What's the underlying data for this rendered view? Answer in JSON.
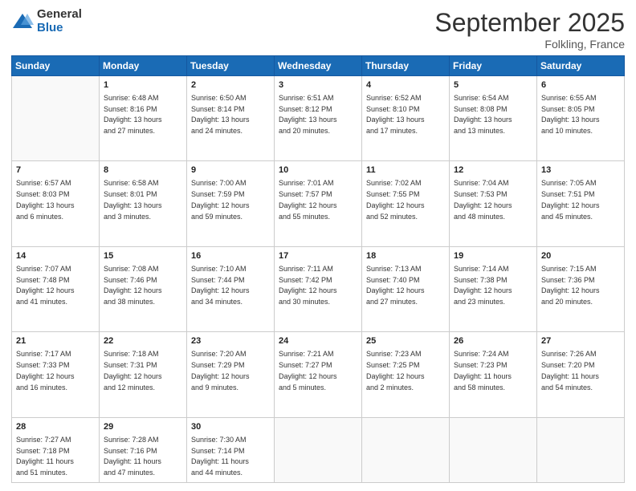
{
  "logo": {
    "general": "General",
    "blue": "Blue"
  },
  "header": {
    "month": "September 2025",
    "location": "Folkling, France"
  },
  "weekdays": [
    "Sunday",
    "Monday",
    "Tuesday",
    "Wednesday",
    "Thursday",
    "Friday",
    "Saturday"
  ],
  "weeks": [
    [
      {
        "day": "",
        "info": ""
      },
      {
        "day": "1",
        "info": "Sunrise: 6:48 AM\nSunset: 8:16 PM\nDaylight: 13 hours\nand 27 minutes."
      },
      {
        "day": "2",
        "info": "Sunrise: 6:50 AM\nSunset: 8:14 PM\nDaylight: 13 hours\nand 24 minutes."
      },
      {
        "day": "3",
        "info": "Sunrise: 6:51 AM\nSunset: 8:12 PM\nDaylight: 13 hours\nand 20 minutes."
      },
      {
        "day": "4",
        "info": "Sunrise: 6:52 AM\nSunset: 8:10 PM\nDaylight: 13 hours\nand 17 minutes."
      },
      {
        "day": "5",
        "info": "Sunrise: 6:54 AM\nSunset: 8:08 PM\nDaylight: 13 hours\nand 13 minutes."
      },
      {
        "day": "6",
        "info": "Sunrise: 6:55 AM\nSunset: 8:05 PM\nDaylight: 13 hours\nand 10 minutes."
      }
    ],
    [
      {
        "day": "7",
        "info": "Sunrise: 6:57 AM\nSunset: 8:03 PM\nDaylight: 13 hours\nand 6 minutes."
      },
      {
        "day": "8",
        "info": "Sunrise: 6:58 AM\nSunset: 8:01 PM\nDaylight: 13 hours\nand 3 minutes."
      },
      {
        "day": "9",
        "info": "Sunrise: 7:00 AM\nSunset: 7:59 PM\nDaylight: 12 hours\nand 59 minutes."
      },
      {
        "day": "10",
        "info": "Sunrise: 7:01 AM\nSunset: 7:57 PM\nDaylight: 12 hours\nand 55 minutes."
      },
      {
        "day": "11",
        "info": "Sunrise: 7:02 AM\nSunset: 7:55 PM\nDaylight: 12 hours\nand 52 minutes."
      },
      {
        "day": "12",
        "info": "Sunrise: 7:04 AM\nSunset: 7:53 PM\nDaylight: 12 hours\nand 48 minutes."
      },
      {
        "day": "13",
        "info": "Sunrise: 7:05 AM\nSunset: 7:51 PM\nDaylight: 12 hours\nand 45 minutes."
      }
    ],
    [
      {
        "day": "14",
        "info": "Sunrise: 7:07 AM\nSunset: 7:48 PM\nDaylight: 12 hours\nand 41 minutes."
      },
      {
        "day": "15",
        "info": "Sunrise: 7:08 AM\nSunset: 7:46 PM\nDaylight: 12 hours\nand 38 minutes."
      },
      {
        "day": "16",
        "info": "Sunrise: 7:10 AM\nSunset: 7:44 PM\nDaylight: 12 hours\nand 34 minutes."
      },
      {
        "day": "17",
        "info": "Sunrise: 7:11 AM\nSunset: 7:42 PM\nDaylight: 12 hours\nand 30 minutes."
      },
      {
        "day": "18",
        "info": "Sunrise: 7:13 AM\nSunset: 7:40 PM\nDaylight: 12 hours\nand 27 minutes."
      },
      {
        "day": "19",
        "info": "Sunrise: 7:14 AM\nSunset: 7:38 PM\nDaylight: 12 hours\nand 23 minutes."
      },
      {
        "day": "20",
        "info": "Sunrise: 7:15 AM\nSunset: 7:36 PM\nDaylight: 12 hours\nand 20 minutes."
      }
    ],
    [
      {
        "day": "21",
        "info": "Sunrise: 7:17 AM\nSunset: 7:33 PM\nDaylight: 12 hours\nand 16 minutes."
      },
      {
        "day": "22",
        "info": "Sunrise: 7:18 AM\nSunset: 7:31 PM\nDaylight: 12 hours\nand 12 minutes."
      },
      {
        "day": "23",
        "info": "Sunrise: 7:20 AM\nSunset: 7:29 PM\nDaylight: 12 hours\nand 9 minutes."
      },
      {
        "day": "24",
        "info": "Sunrise: 7:21 AM\nSunset: 7:27 PM\nDaylight: 12 hours\nand 5 minutes."
      },
      {
        "day": "25",
        "info": "Sunrise: 7:23 AM\nSunset: 7:25 PM\nDaylight: 12 hours\nand 2 minutes."
      },
      {
        "day": "26",
        "info": "Sunrise: 7:24 AM\nSunset: 7:23 PM\nDaylight: 11 hours\nand 58 minutes."
      },
      {
        "day": "27",
        "info": "Sunrise: 7:26 AM\nSunset: 7:20 PM\nDaylight: 11 hours\nand 54 minutes."
      }
    ],
    [
      {
        "day": "28",
        "info": "Sunrise: 7:27 AM\nSunset: 7:18 PM\nDaylight: 11 hours\nand 51 minutes."
      },
      {
        "day": "29",
        "info": "Sunrise: 7:28 AM\nSunset: 7:16 PM\nDaylight: 11 hours\nand 47 minutes."
      },
      {
        "day": "30",
        "info": "Sunrise: 7:30 AM\nSunset: 7:14 PM\nDaylight: 11 hours\nand 44 minutes."
      },
      {
        "day": "",
        "info": ""
      },
      {
        "day": "",
        "info": ""
      },
      {
        "day": "",
        "info": ""
      },
      {
        "day": "",
        "info": ""
      }
    ]
  ]
}
